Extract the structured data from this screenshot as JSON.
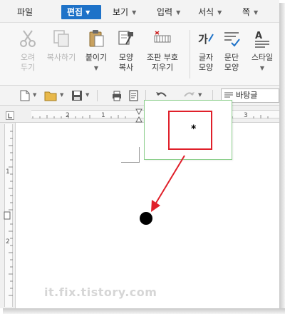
{
  "menubar": {
    "file": "파일",
    "edit": "편집",
    "view": "보기",
    "input": "입력",
    "format": "서식",
    "page": "쪽"
  },
  "ribbon": {
    "cut": [
      "오려",
      "두기"
    ],
    "copy": "복사하기",
    "paste": "붙이기",
    "format_copy": [
      "모양",
      "복사"
    ],
    "clear_marks": [
      "조판 부호",
      "지우기"
    ],
    "char_format": [
      "글자",
      "모양"
    ],
    "para_format": [
      "문단",
      "모양"
    ],
    "style": "스타일"
  },
  "toolbar": {
    "style_value": "바탕글"
  },
  "ruler": {
    "h_numbers": [
      "2",
      "1",
      "3"
    ],
    "v_numbers": [
      "1",
      "2"
    ]
  },
  "zoom_popup": {
    "marker": "*"
  },
  "watermark": "it.fix.tistory.com",
  "colors": {
    "accent_blue": "#1e72c8",
    "annotation_red": "#e0202a",
    "popup_border": "#8ed08e"
  }
}
